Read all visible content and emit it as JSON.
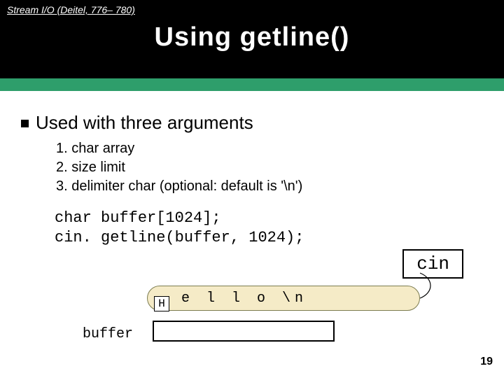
{
  "header": {
    "breadcrumb": "Stream I/O (Deitel, 776– 780)",
    "title": "Using getline()"
  },
  "main_point": "Used with three arguments",
  "args": [
    "char array",
    "size limit",
    "delimiter char (optional: default is '\\n')"
  ],
  "code": {
    "line1": "char buffer[1024];",
    "line2": "cin. getline(buffer, 1024);"
  },
  "diagram": {
    "cin_label": "cin",
    "first_char": "H",
    "stream_chars": "e l l o \\n",
    "buffer_label": "buffer"
  },
  "page_number": "19"
}
